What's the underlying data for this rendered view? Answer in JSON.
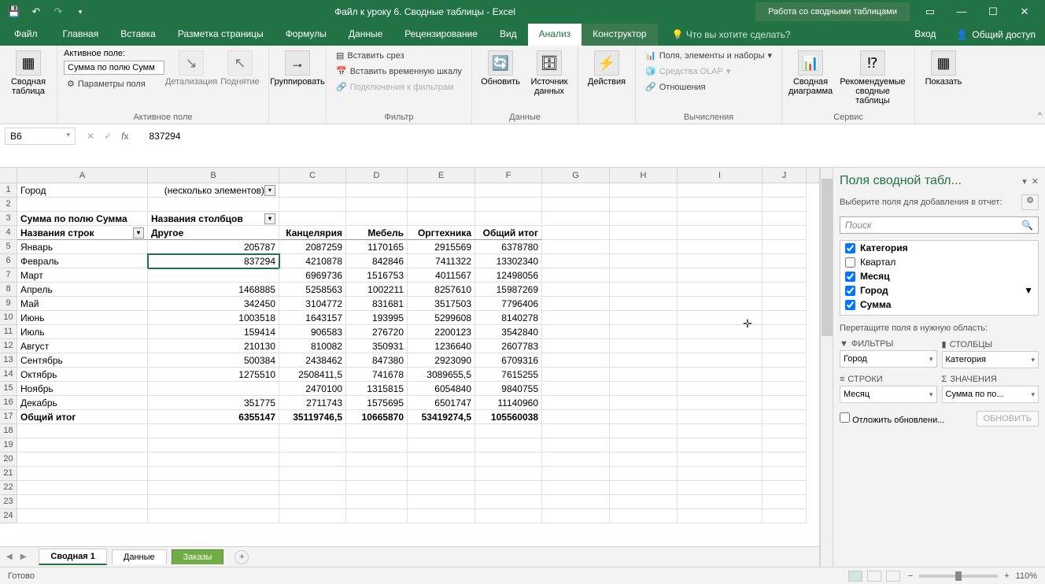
{
  "titlebar": {
    "doc_title": "Файл к уроку 6. Сводные таблицы - Excel",
    "context_title": "Работа со сводными таблицами"
  },
  "tabs": {
    "file": "Файл",
    "home": "Главная",
    "insert": "Вставка",
    "layout": "Разметка страницы",
    "formulas": "Формулы",
    "data": "Данные",
    "review": "Рецензирование",
    "view": "Вид",
    "analyze": "Анализ",
    "design": "Конструктор",
    "tellme": "Что вы хотите сделать?",
    "signin": "Вход",
    "share": "Общий доступ"
  },
  "ribbon": {
    "pivot_table_btn": "Сводная таблица",
    "active_field_label": "Активное поле:",
    "active_field_value": "Сумма по полю Сумм",
    "field_settings": "Параметры поля",
    "drilldown": "Детализация",
    "drillup": "Поднятие",
    "group_active_field": "Активное поле",
    "group_btn": "Группировать",
    "insert_slicer": "Вставить срез",
    "insert_timeline": "Вставить временную шкалу",
    "filter_connections": "Подключения к фильтрам",
    "group_filter": "Фильтр",
    "refresh": "Обновить",
    "change_source": "Источник данных",
    "group_data": "Данные",
    "actions": "Действия",
    "fields_items": "Поля, элементы и наборы",
    "olap_tools": "Средства OLAP",
    "relationships": "Отношения",
    "group_calc": "Вычисления",
    "pivot_chart": "Сводная диаграмма",
    "recommended": "Рекомендуемые сводные таблицы",
    "group_tools": "Сервис",
    "show": "Показать"
  },
  "namebox": {
    "ref": "B6",
    "value": "837294"
  },
  "grid": {
    "cols": [
      "A",
      "B",
      "C",
      "D",
      "E",
      "F",
      "G",
      "H",
      "I",
      "J"
    ],
    "r1": {
      "a": "Город",
      "b": "(несколько элементов)"
    },
    "r3": {
      "a": "Сумма по полю Сумма",
      "b": "Названия столбцов"
    },
    "r4": {
      "a": "Названия строк",
      "b": "Другое",
      "c": "Канцелярия",
      "d": "Мебель",
      "e": "Оргтехника",
      "f": "Общий итог"
    },
    "data": [
      {
        "m": "Январь",
        "b": "205787",
        "c": "2087259",
        "d": "1170165",
        "e": "2915569",
        "f": "6378780"
      },
      {
        "m": "Февраль",
        "b": "837294",
        "c": "4210878",
        "d": "842846",
        "e": "7411322",
        "f": "13302340"
      },
      {
        "m": "Март",
        "b": "",
        "c": "6969736",
        "d": "1516753",
        "e": "4011567",
        "f": "12498056"
      },
      {
        "m": "Апрель",
        "b": "1468885",
        "c": "5258563",
        "d": "1002211",
        "e": "8257610",
        "f": "15987269"
      },
      {
        "m": "Май",
        "b": "342450",
        "c": "3104772",
        "d": "831681",
        "e": "3517503",
        "f": "7796406"
      },
      {
        "m": "Июнь",
        "b": "1003518",
        "c": "1643157",
        "d": "193995",
        "e": "5299608",
        "f": "8140278"
      },
      {
        "m": "Июль",
        "b": "159414",
        "c": "906583",
        "d": "276720",
        "e": "2200123",
        "f": "3542840"
      },
      {
        "m": "Август",
        "b": "210130",
        "c": "810082",
        "d": "350931",
        "e": "1236640",
        "f": "2607783"
      },
      {
        "m": "Сентябрь",
        "b": "500384",
        "c": "2438462",
        "d": "847380",
        "e": "2923090",
        "f": "6709316"
      },
      {
        "m": "Октябрь",
        "b": "1275510",
        "c": "2508411,5",
        "d": "741678",
        "e": "3089655,5",
        "f": "7615255"
      },
      {
        "m": "Ноябрь",
        "b": "",
        "c": "2470100",
        "d": "1315815",
        "e": "6054840",
        "f": "9840755"
      },
      {
        "m": "Декабрь",
        "b": "351775",
        "c": "2711743",
        "d": "1575695",
        "e": "6501747",
        "f": "11140960"
      }
    ],
    "total": {
      "m": "Общий итог",
      "b": "6355147",
      "c": "35119746,5",
      "d": "10665870",
      "e": "53419274,5",
      "f": "105560038"
    }
  },
  "sheets": {
    "s1": "Сводная 1",
    "s2": "Данные",
    "s3": "Заказы"
  },
  "status": {
    "ready": "Готово",
    "zoom": "110%"
  },
  "fieldpane": {
    "title": "Поля сводной табл...",
    "subtitle": "Выберите поля для добавления в отчет:",
    "search": "Поиск",
    "fields": {
      "category": "Категория",
      "quarter": "Квартал",
      "month": "Месяц",
      "city": "Город",
      "sum": "Сумма"
    },
    "drag_hint": "Перетащите поля в нужную область:",
    "areas": {
      "filters": "ФИЛЬТРЫ",
      "columns": "СТОЛБЦЫ",
      "rows": "СТРОКИ",
      "values": "ЗНАЧЕНИЯ",
      "filter_val": "Город",
      "column_val": "Категория",
      "row_val": "Месяц",
      "value_val": "Сумма по по..."
    },
    "defer": "Отложить обновлени...",
    "update": "ОБНОВИТЬ"
  }
}
